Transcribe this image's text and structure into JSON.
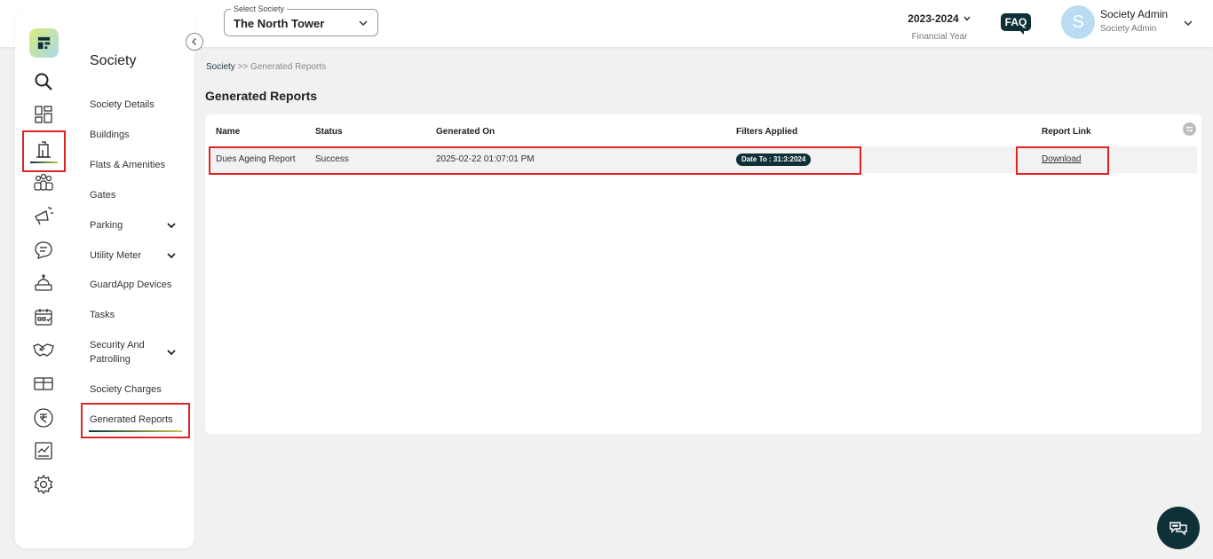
{
  "topbar": {
    "society_select_label": "Select Society",
    "society_select_value": "The North Tower",
    "financial_year": "2023-2024",
    "financial_year_label": "Financial Year",
    "faq_label": "FAQ",
    "avatar_initial": "S",
    "user_name": "Society Admin",
    "user_role": "Society Admin"
  },
  "rail": {
    "icons": [
      "search-icon",
      "dashboard-icon",
      "building-icon",
      "residents-icon",
      "announcement-icon",
      "chat-icon",
      "helpdesk-icon",
      "calendar-icon",
      "handshake-icon",
      "inventory-icon",
      "rupee-icon",
      "report-icon",
      "settings-icon"
    ],
    "active": "building-icon"
  },
  "menu": {
    "title": "Society",
    "items": [
      {
        "label": "Society Details"
      },
      {
        "label": "Buildings"
      },
      {
        "label": "Flats & Amenities"
      },
      {
        "label": "Gates"
      },
      {
        "label": "Parking"
      },
      {
        "label": "Utility Meter"
      },
      {
        "label": "GuardApp Devices"
      },
      {
        "label": "Tasks"
      },
      {
        "label": "Security And Patrolling"
      },
      {
        "label": "Society Charges"
      },
      {
        "label": "Generated Reports"
      }
    ],
    "active": "Generated Reports"
  },
  "breadcrumb": {
    "root": "Society",
    "separator": ">>",
    "current": "Generated Reports"
  },
  "page_title": "Generated Reports",
  "table": {
    "headers": [
      "Name",
      "Status",
      "Generated On",
      "Filters Applied",
      "Report Link"
    ],
    "rows": [
      {
        "name": "Dues Ageing Report",
        "status": "Success",
        "generated_on": "2025-02-22 01:07:01 PM",
        "filter": "Date To : 31:3:2024",
        "link": "Download"
      }
    ]
  },
  "colors": {
    "primary": "#0e3138",
    "highlight": "#e02424",
    "accent": "#c8c24a",
    "background": "#f1f1f1"
  }
}
